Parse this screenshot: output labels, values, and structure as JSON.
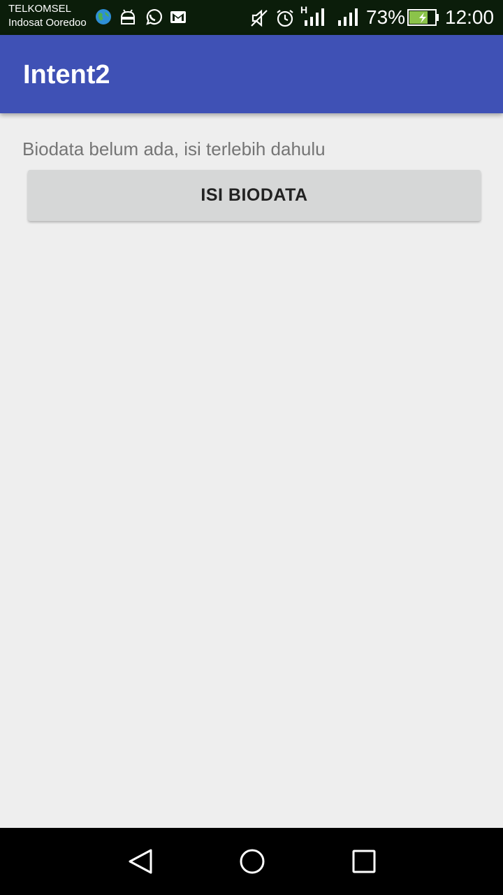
{
  "status_bar": {
    "carrier_1": "TELKOMSEL",
    "carrier_2": "Indosat Ooredoo",
    "network_type": "H",
    "battery_percent": "73%",
    "battery_level": 0.73,
    "time": "12:00",
    "icons": [
      "globe-icon",
      "android-icon",
      "whatsapp-icon",
      "gmail-icon",
      "mute-icon",
      "alarm-icon",
      "signal-icon",
      "signal-icon",
      "battery-charging-icon"
    ]
  },
  "app_bar": {
    "title": "Intent2",
    "color": "#3f51b5"
  },
  "main": {
    "message": "Biodata belum ada, isi terlebih dahulu",
    "button_label": "ISI BIODATA"
  },
  "nav_bar": {
    "icons": [
      "back-icon",
      "home-icon",
      "recents-icon"
    ]
  }
}
